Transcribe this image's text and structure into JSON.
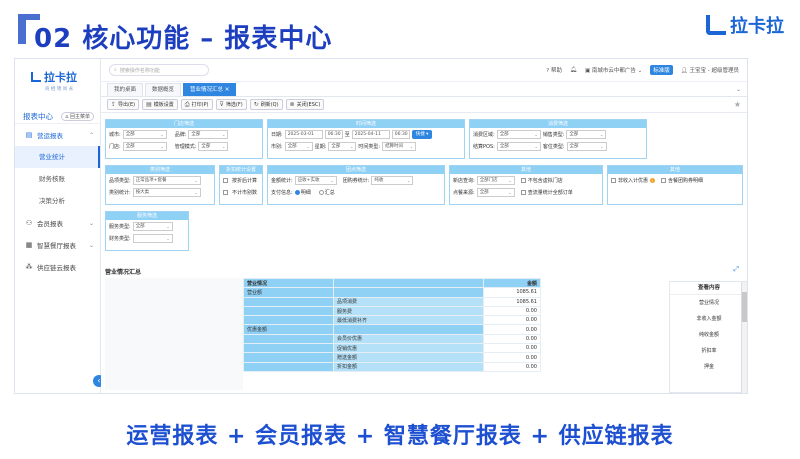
{
  "slide": {
    "title": "02 核心功能 – 报表中心",
    "brand": "拉卡拉",
    "caption": "运营报表 + 会员报表 + 智慧餐厅报表 + 供应链报表"
  },
  "app": {
    "logo": "拉卡拉",
    "logo_sub": "商 栖 锦 尚 永",
    "search_placeholder": "搜索操作名称功能",
    "section_title": "报表中心",
    "home_button": "回主菜单",
    "menu": [
      {
        "label": "营运报表",
        "icon": "chart-icon",
        "expanded": true,
        "children": [
          "营业统计",
          "财务核账",
          "决策分析"
        ]
      },
      {
        "label": "会员报表",
        "icon": "member-icon"
      },
      {
        "label": "智慧餐厅报表",
        "icon": "restaurant-icon"
      },
      {
        "label": "供应链云报表",
        "icon": "supply-icon"
      }
    ],
    "topbar": {
      "help": "帮助",
      "store": "南城市云中都广告",
      "edition": "标准版",
      "user": "王宝宝 - 超级管理员"
    },
    "tabs": [
      {
        "label": "我的桌面"
      },
      {
        "label": "数据概览"
      },
      {
        "label": "营业情况汇总",
        "active": true
      }
    ],
    "toolbar": [
      "导出(E)",
      "模板设置",
      "打印(P)",
      "筛选(F)",
      "刷新(Q)",
      "关闭(ESC)"
    ]
  },
  "filters": {
    "store": {
      "header": "门店筛选",
      "city_label": "城市:",
      "city_value": "全部",
      "brand_label": "品牌:",
      "brand_value": "全部",
      "shop_label": "门店:",
      "shop_value": "全部",
      "mode_label": "管理模式:",
      "mode_value": "全部"
    },
    "time": {
      "header": "时间筛选",
      "date_label": "日期:",
      "start_date": "2025-03-01",
      "start_time": "06:30",
      "to": "至",
      "end_date": "2025-04-11",
      "end_time": "06:30",
      "quick": "快捷",
      "shift_label": "市别:",
      "shift_value": "全部",
      "period_label": "星期:",
      "period_value": "全部",
      "timetype_label": "时间类型:",
      "timetype_value": "结算时间"
    },
    "consume": {
      "header": "消费筛选",
      "area_label": "消费区域:",
      "area_value": "全部",
      "sale_label": "销售类型:",
      "sale_value": "全部",
      "pos_label": "结算POS:",
      "pos_value": "全部",
      "guest_label": "客位类型:",
      "guest_value": "全部"
    },
    "category": {
      "header": "类别筛选",
      "type_label": "品项类型:",
      "type_value": "正常品项+套餐",
      "stat_label": "类别统计:",
      "stat_value": "按大类"
    },
    "discount": {
      "header": "折扣统计设置",
      "opt1": "按折后计算",
      "opt2": "不计市别数"
    },
    "group": {
      "header": "团点筛选",
      "stat_label": "金额统计:",
      "stat_value": "应收+实收",
      "group_label": "团购券统计:",
      "group_value": "纯收",
      "pay_label": "支付信息:",
      "pay_opt1": "明细",
      "pay_opt2": "汇总"
    },
    "other": {
      "header": "其他",
      "newshop_label": "新店查询:",
      "newshop_value": "全部门店",
      "src_label": "点餐来源:",
      "src_value": "全部",
      "opt1": "不包含虚拟门店",
      "opt2": "查流量统计全部订单"
    },
    "others2": {
      "header": "其他",
      "opt1": "非收入计优惠",
      "opt2": "含餐团购券明细"
    },
    "service": {
      "header": "服务筛选",
      "service_label": "服务类型:",
      "service_value": "全部",
      "fin_label": "财务类型:",
      "fin_value": ""
    }
  },
  "report": {
    "section_title": "营业情况汇总",
    "header": [
      "营业情况",
      "",
      "金额"
    ],
    "rows": [
      {
        "c1": "营业额",
        "c2": "",
        "c3": "1085.61"
      },
      {
        "c1": "",
        "c2": "品项消费",
        "c3": "1085.61"
      },
      {
        "c1": "",
        "c2": "服务费",
        "c3": "0.00"
      },
      {
        "c1": "",
        "c2": "最低消费补齐",
        "c3": "0.00"
      },
      {
        "c1": "优惠金额",
        "c2": "",
        "c3": "0.00"
      },
      {
        "c1": "",
        "c2": "会员价优惠",
        "c3": "0.00"
      },
      {
        "c1": "",
        "c2": "促销优惠",
        "c3": "0.00"
      },
      {
        "c1": "",
        "c2": "赠送金额",
        "c3": "0.00"
      },
      {
        "c1": "",
        "c2": "折扣金额",
        "c3": "0.00"
      }
    ]
  },
  "view_panel": {
    "title": "查看内容",
    "items": [
      "营业情况",
      "非收入金额",
      "纯收金额",
      "折扣率",
      "押金"
    ]
  }
}
